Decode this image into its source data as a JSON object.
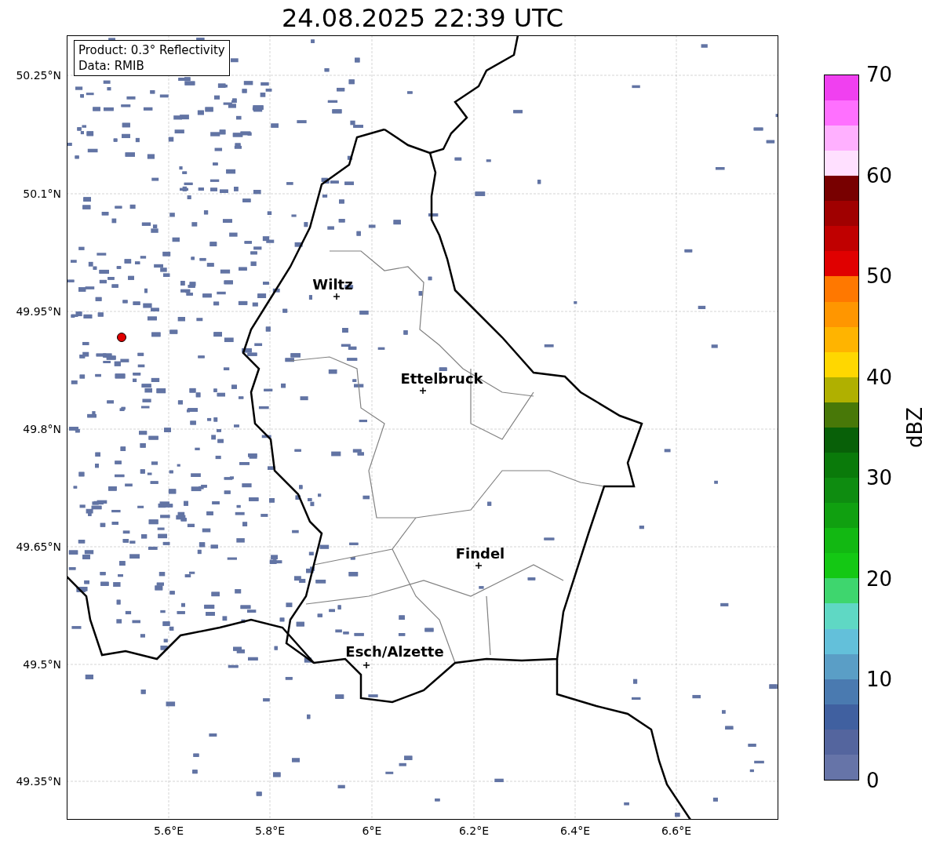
{
  "title": "24.08.2025 22:39 UTC",
  "info_box": [
    "Product: 0.3° Reflectivity",
    "Data: RMIB"
  ],
  "lat_ticks": [
    "50.25°N",
    "50.1°N",
    "49.95°N",
    "49.8°N",
    "49.65°N",
    "49.5°N",
    "49.35°N"
  ],
  "lon_ticks": [
    "5.6°E",
    "5.8°E",
    "6°E",
    "6.2°E",
    "6.4°E",
    "6.6°E"
  ],
  "cities": [
    {
      "name": "Wiltz"
    },
    {
      "name": "Ettelbruck"
    },
    {
      "name": "Findel"
    },
    {
      "name": "Esch/Alzette"
    }
  ],
  "colorbar": {
    "label": "dBZ",
    "ticks": [
      "70",
      "60",
      "50",
      "40",
      "30",
      "20",
      "10",
      "0"
    ],
    "colors": [
      {
        "color": "#6674a8"
      },
      {
        "color": "#54659e"
      },
      {
        "color": "#4060a0"
      },
      {
        "color": "#4a7ab0"
      },
      {
        "color": "#5a9ec6"
      },
      {
        "color": "#63c0da"
      },
      {
        "color": "#5fd8c4"
      },
      {
        "color": "#3ed66e"
      },
      {
        "color": "#14c814"
      },
      {
        "color": "#12b812"
      },
      {
        "color": "#10a010"
      },
      {
        "color": "#0e8c10"
      },
      {
        "color": "#0a7a0a"
      },
      {
        "color": "#086008"
      },
      {
        "color": "#487808"
      },
      {
        "color": "#b0b000"
      },
      {
        "color": "#ffd700"
      },
      {
        "color": "#ffb400"
      },
      {
        "color": "#ff9600"
      },
      {
        "color": "#ff7800"
      },
      {
        "color": "#e00000"
      },
      {
        "color": "#c00000"
      },
      {
        "color": "#a00000"
      },
      {
        "color": "#780000"
      },
      {
        "color": "#ffe0ff"
      },
      {
        "color": "#ffb0ff"
      },
      {
        "color": "#ff70ff"
      },
      {
        "color": "#f040f0"
      }
    ]
  }
}
